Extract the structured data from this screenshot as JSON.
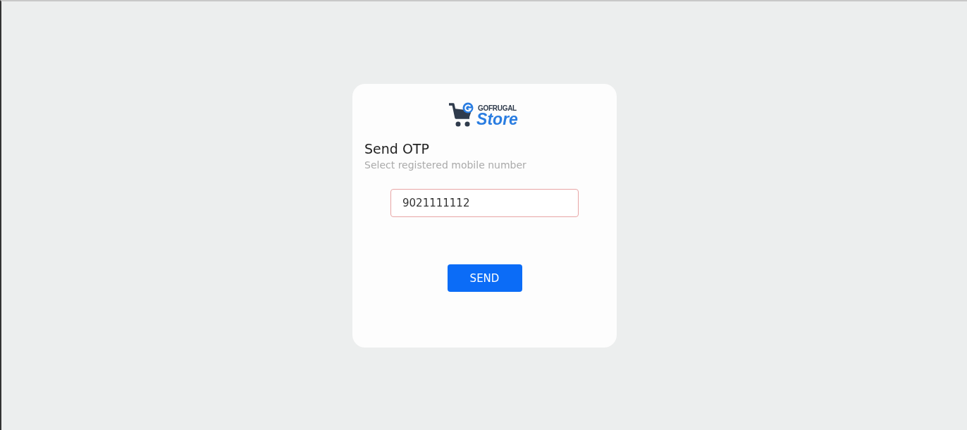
{
  "logo": {
    "brand": "GOFRUGAL",
    "product": "Store"
  },
  "heading": "Send OTP",
  "subheading": "Select registered mobile number",
  "mobile_field": {
    "value": "9021111112"
  },
  "send_button": {
    "label": "SEND"
  }
}
